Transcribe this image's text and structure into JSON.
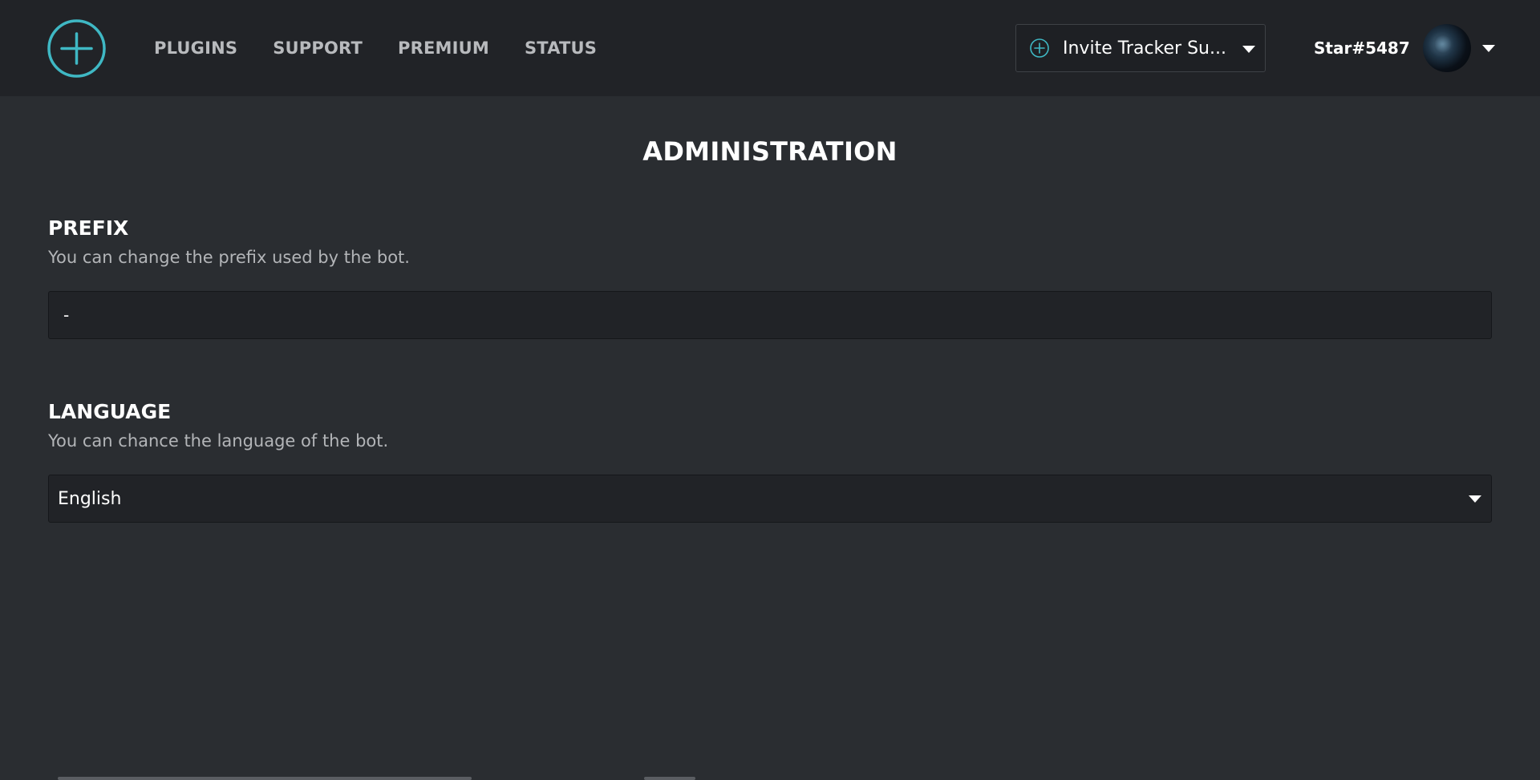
{
  "header": {
    "logo_icon": "plus-circle-icon",
    "nav": [
      "PLUGINS",
      "SUPPORT",
      "PREMIUM",
      "STATUS"
    ],
    "server_selector": {
      "icon": "plus-circle-icon",
      "value": "Invite Tracker Su..."
    },
    "user": {
      "name": "Star#5487"
    }
  },
  "main": {
    "title": "ADMINISTRATION",
    "prefix": {
      "title": "PREFIX",
      "description": "You can change the prefix used by the bot.",
      "value": "-"
    },
    "language": {
      "title": "LANGUAGE",
      "description": "You can chance the language of the bot.",
      "selected": "English"
    }
  },
  "colors": {
    "accent": "#3fb8c4",
    "header_bg": "#212327",
    "page_bg": "#2a2d31",
    "field_bg": "#212327"
  }
}
